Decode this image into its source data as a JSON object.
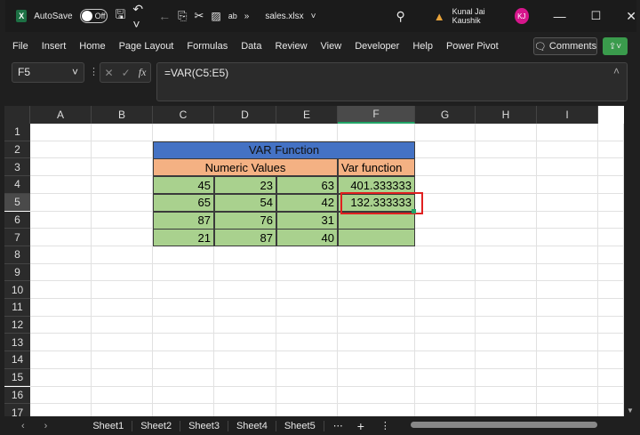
{
  "titlebar": {
    "app_icon": "excel-icon",
    "autosave_label": "AutoSave",
    "autosave_state": "Off",
    "filename": "sales.xlsx",
    "user": "Kunal Jai Kaushik",
    "initials": "KJ"
  },
  "menu": [
    "File",
    "Insert",
    "Home",
    "Page Layout",
    "Formulas",
    "Data",
    "Review",
    "View",
    "Developer",
    "Help",
    "Power Pivot"
  ],
  "comments_label": "Comments",
  "formula_bar": {
    "name_box": "F5",
    "formula": "=VAR(C5:E5)",
    "fx": "fx"
  },
  "columns": [
    "A",
    "B",
    "C",
    "D",
    "E",
    "F",
    "G",
    "H",
    "I"
  ],
  "rows": [
    "1",
    "2",
    "3",
    "4",
    "5",
    "6",
    "7",
    "8",
    "9",
    "10",
    "11",
    "12",
    "13",
    "14",
    "15",
    "16",
    "17"
  ],
  "selected_cell": "F5",
  "table": {
    "title": "VAR Function",
    "header_values": "Numeric Values",
    "header_var": "Var function",
    "rows": [
      [
        "45",
        "23",
        "63",
        "401.333333"
      ],
      [
        "65",
        "54",
        "42",
        "132.333333"
      ],
      [
        "87",
        "76",
        "31",
        ""
      ],
      [
        "21",
        "87",
        "40",
        ""
      ]
    ]
  },
  "colors": {
    "title_bg": "#4472c4",
    "header_bg": "#f4b183",
    "data_bg": "#a9d18e",
    "highlight": "#e02020",
    "accent": "#21a366"
  },
  "sheets": [
    "Sheet1",
    "Sheet2",
    "Sheet3",
    "Sheet4",
    "Sheet5"
  ]
}
